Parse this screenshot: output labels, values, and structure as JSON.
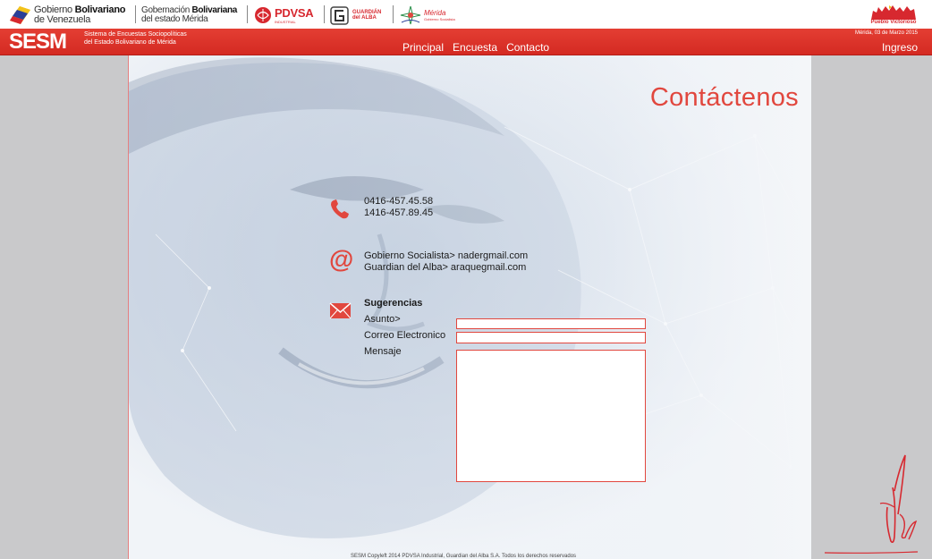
{
  "header": {
    "gov_line1_light": "Gobierno ",
    "gov_line1_bold": "Bolivariano",
    "gov_line2": "de Venezuela",
    "gob_line1_light": "Gobernación ",
    "gob_line1_bold": "Bolivariana",
    "gob_line2": "del estado Mérida",
    "pdvsa": "PDVSA",
    "pdvsa_sub": "INDUSTRIAL",
    "alba_line1": "GUARDIÁN",
    "alba_line2": "del ALBA",
    "merida": "Mérida",
    "merida_sub": "Gobierno Socialista",
    "pueblo": "Pueblo Victorioso"
  },
  "brand": {
    "logo": "SESM",
    "subtitle_line1": "Sistema de Encuestas Sociopolíticas",
    "subtitle_line2": "del Estado Bolivariano de Mérida"
  },
  "nav": {
    "items": [
      "Principal",
      "Encuesta",
      "Contacto"
    ]
  },
  "date": "Mérida, 03 de Marzo 2015",
  "login_label": "Ingreso",
  "page": {
    "title": "Contáctenos"
  },
  "contact": {
    "phone1": "0416-457.45.58",
    "phone2": "1416-457.89.45",
    "email1": "Gobierno Socialista> nadergmail.com",
    "email2": "Guardian del Alba> araquegmail.com"
  },
  "form": {
    "heading": "Sugerencias",
    "subject_label": "Asunto>",
    "email_label": "Correo Electronico",
    "message_label": "Mensaje",
    "subject_value": "",
    "email_value": "",
    "message_value": ""
  },
  "footer": {
    "text": "SESM Copyleft 2014 PDVSA Industrial, Guardian del Alba S.A. Todos los derechos reservados"
  },
  "colors": {
    "accent": "#e1473e",
    "header_red": "#d42a22",
    "side_gray": "#c9c9cb"
  }
}
